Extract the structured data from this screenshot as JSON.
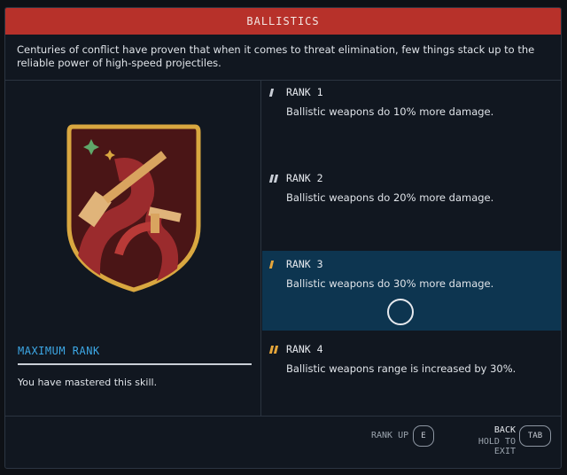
{
  "title": "BALLISTICS",
  "description": "Centuries of conflict have proven that when it comes to threat elimination, few things stack up to the reliable power of high-speed projectiles.",
  "status": {
    "heading": "MAXIMUM RANK",
    "text": "You have mastered this skill."
  },
  "ranks": [
    {
      "label": "RANK 1",
      "desc": "Ballistic weapons do 10% more damage."
    },
    {
      "label": "RANK 2",
      "desc": "Ballistic weapons do 20% more damage."
    },
    {
      "label": "RANK 3",
      "desc": "Ballistic weapons do 30% more damage."
    },
    {
      "label": "RANK 4",
      "desc": "Ballistic weapons range is increased by 30%."
    }
  ],
  "footer": {
    "rank_up": "RANK UP",
    "rank_up_key": "E",
    "back": "BACK",
    "hold_to_exit": "HOLD TO EXIT",
    "back_key": "TAB"
  },
  "colors": {
    "title_bar": "#b7312a",
    "accent_blue": "#3da8e6",
    "active_rank": "#0d3550",
    "pip_gold": "#e6a63a"
  }
}
